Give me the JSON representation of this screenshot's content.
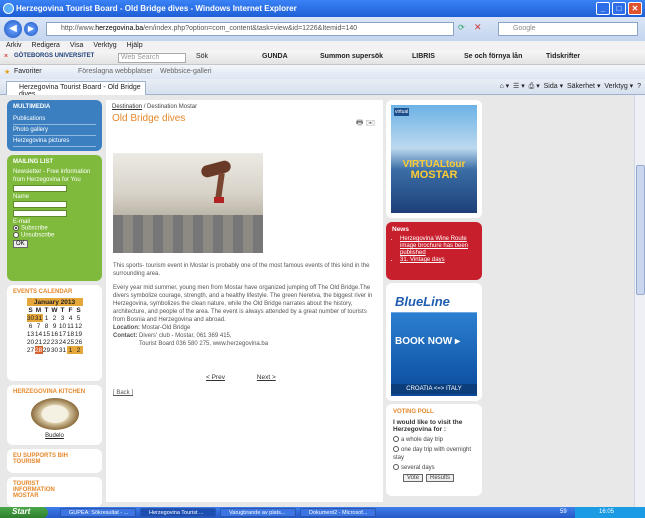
{
  "window": {
    "title": "Herzegovina Tourist Board - Old Bridge dives - Windows Internet Explorer"
  },
  "address": {
    "url_domain": "herzegovina.ba",
    "url_rest": "/en/index.php?option=com_content&task=view&id=1226&Itemid=140",
    "prefix": "http://www.",
    "search_placeholder": "Google"
  },
  "menu": [
    "Arkiv",
    "Redigera",
    "Visa",
    "Verktyg",
    "Hjälp"
  ],
  "linkbar": {
    "brand": "GÖTEBORGS UNIVERSITET",
    "search_placeholder": "Web Search",
    "sok": "Sök",
    "gunda": "GUNDA",
    "summon": "Summon supersök",
    "libris": "LIBRIS",
    "fornya": "Se och förnya lån",
    "tidskrifter": "Tidskrifter"
  },
  "favbar": {
    "favorites": "Favoriter",
    "suggested": "Föreslagna webbplatser",
    "gallery": "Webbsice-galleri"
  },
  "tab": {
    "label": "Herzegovina Tourist Board - Old Bridge dives"
  },
  "cmd": {
    "page": "Sida",
    "security": "Säkerhet",
    "tools": "Verktyg"
  },
  "left": {
    "multimedia": {
      "title": "MULTIMEDIA",
      "links": [
        "Publications",
        "Photo gallery",
        "Herzegovina pictures"
      ]
    },
    "mailing": {
      "title": "MAILING LIST",
      "text": "Newsletter - Free information from Herzegovina for You",
      "name_label": "Name",
      "email_label": "E-mail",
      "subscribe": "Subscribe",
      "unsubscribe": "Unsubscribe",
      "ok": "OK"
    },
    "calendar": {
      "title": "EVENTS CALENDAR",
      "month": "January 2013",
      "days": [
        "S",
        "M",
        "T",
        "W",
        "T",
        "F",
        "S"
      ],
      "weeks": [
        [
          "30",
          "31",
          "1",
          "2",
          "3",
          "4",
          "5"
        ],
        [
          "6",
          "7",
          "8",
          "9",
          "10",
          "11",
          "12"
        ],
        [
          "13",
          "14",
          "15",
          "16",
          "17",
          "18",
          "19"
        ],
        [
          "20",
          "21",
          "22",
          "23",
          "24",
          "25",
          "26"
        ],
        [
          "27",
          "28",
          "29",
          "30",
          "31",
          "1",
          "2"
        ]
      ]
    },
    "kitchen": {
      "title": "HERZEGOVINA KITCHEN",
      "caption": "Budelo"
    },
    "eu": {
      "title": "EU SUPPORTS BIH TOURISM"
    },
    "info": {
      "title": "TOURIST INFORMATION MOSTAR"
    }
  },
  "main": {
    "crumb_home": "Destination",
    "crumb_sep": "/",
    "crumb_current": "Destination Mostar",
    "title": "Old Bridge dives",
    "tools": "🖶 ✉",
    "p1": "This sports- tourism event in Mostar is probably one of the most famous events of this kind in the surrounding area.",
    "p2": "Every year mid summer, young men from Mostar have organized jumping off The Old Bridge.The divers symbolize courage, strength, and a healthy lifestyle. The green Neretva, the biggest river in Herzegovina, symbolizes the clean nature, while the Old Bridge narrates about the history, architecture, and people of the area. The event is always attended by a great number of tourists from Bosnia and Herzegovina and abroad.",
    "location_label": "Location:",
    "location": "Mostar-Old Bridge",
    "contact_label": "Contact:",
    "contact": "Divers' club - Mostar, 061 369 415,",
    "contact2": "Tourist Board 036 580 275, www.herzegovina.ba",
    "prev": "< Prev",
    "next": "Next >",
    "back": "[ Back ]"
  },
  "right": {
    "ad1": {
      "logo": "virtual",
      "line1": "VIRTUALtour",
      "line2": "MOSTAR"
    },
    "news": {
      "title": "News",
      "items": [
        "Herzegovina Wine Route image brochure has been published",
        "31. Vintage days"
      ]
    },
    "ad2": {
      "brand": "BlueLine",
      "cta": "BOOK NOW ▸",
      "route": "CROATIA <=> ITALY"
    },
    "poll": {
      "title": "VOTING POLL",
      "question": "I would like to visit the Herzegovina for :",
      "options": [
        "a whole day trip",
        "one day trip with overnight stay",
        "several days"
      ],
      "vote": "Vote",
      "results": "Results"
    }
  },
  "taskbar": {
    "start": "Start",
    "tasks": [
      "GUPEA: Sökresultat - ...",
      "Herzegovina Tourist ...",
      "Varugbrande av plats...",
      "Dokument2 - Microsof..."
    ],
    "num": "59",
    "time": "16:05"
  }
}
